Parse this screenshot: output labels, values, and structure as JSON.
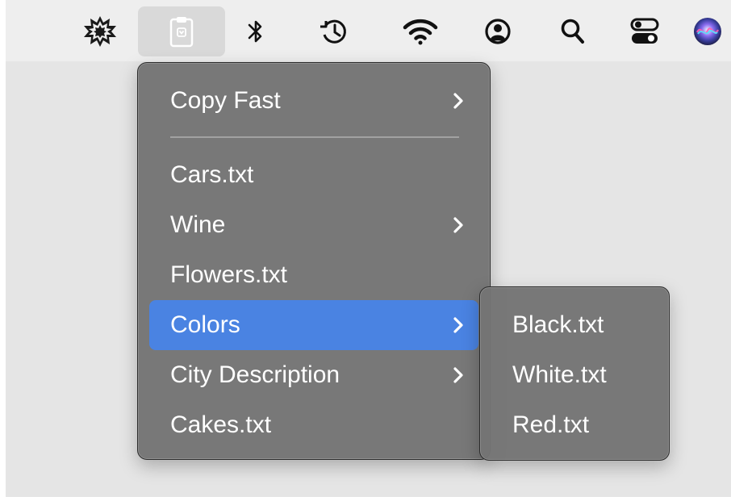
{
  "menubar": {
    "items": [
      {
        "icon": "burst-settings-icon"
      },
      {
        "icon": "clipboard-icon",
        "active": true
      },
      {
        "icon": "bluetooth-icon"
      },
      {
        "icon": "time-machine-icon"
      },
      {
        "icon": "wifi-icon"
      },
      {
        "icon": "user-account-icon"
      },
      {
        "icon": "search-icon"
      },
      {
        "icon": "control-center-icon"
      },
      {
        "icon": "siri-icon"
      }
    ]
  },
  "menu": {
    "items": [
      {
        "label": "Copy Fast",
        "submenu": true
      },
      {
        "label": "Cars.txt",
        "submenu": false
      },
      {
        "label": "Wine",
        "submenu": true
      },
      {
        "label": "Flowers.txt",
        "submenu": false
      },
      {
        "label": "Colors",
        "submenu": true,
        "highlighted": true
      },
      {
        "label": "City Description",
        "submenu": true
      },
      {
        "label": "Cakes.txt",
        "submenu": false
      }
    ]
  },
  "submenu": {
    "items": [
      {
        "label": "Black.txt"
      },
      {
        "label": "White.txt"
      },
      {
        "label": "Red.txt"
      }
    ]
  },
  "colors": {
    "menu_bg": "#747474",
    "highlight": "#4a83e2",
    "text": "#ffffff"
  }
}
